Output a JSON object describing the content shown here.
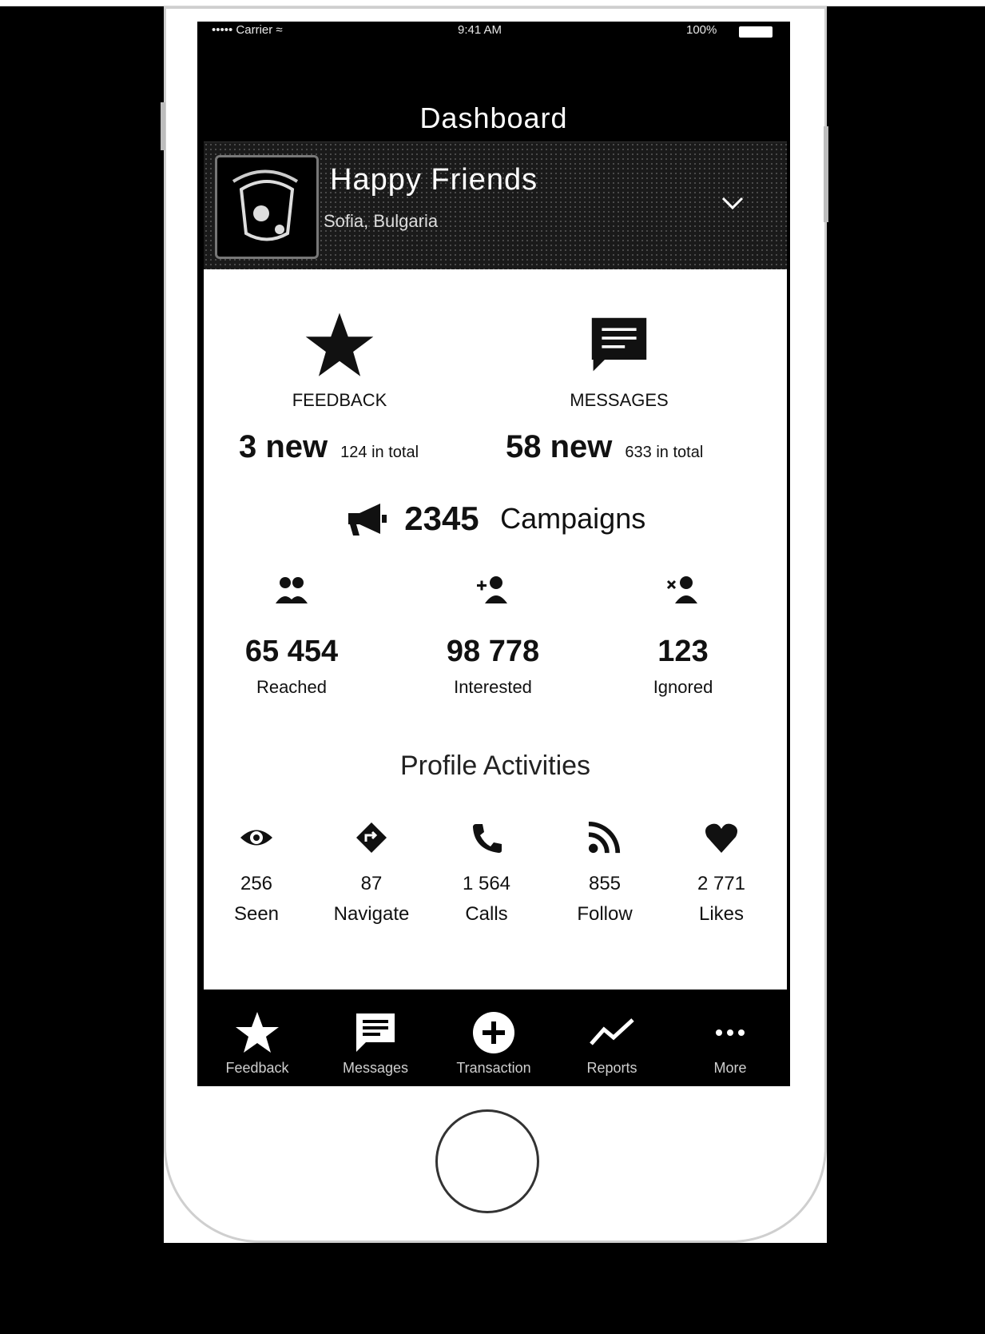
{
  "status_bar": {
    "carrier": "••••• Carrier ≈",
    "time": "9:41 AM",
    "battery": "100%"
  },
  "nav": {
    "title": "Dashboard"
  },
  "profile": {
    "name": "Happy Friends",
    "location": "Sofia, Bulgaria"
  },
  "feedback": {
    "label": "FEEDBACK",
    "new": "3 new",
    "total": "124 in total"
  },
  "messages": {
    "label": "MESSAGES",
    "new": "58 new",
    "total": "633 in total"
  },
  "campaigns": {
    "count": "2345",
    "label": "Campaigns"
  },
  "audience": [
    {
      "icon": "group-icon",
      "value": "65 454",
      "label": "Reached"
    },
    {
      "icon": "add-user-icon",
      "value": "98 778",
      "label": "Interested"
    },
    {
      "icon": "remove-user-icon",
      "value": "123",
      "label": "Ignored"
    }
  ],
  "profile_activities": {
    "title": "Profile Activities",
    "items": [
      {
        "icon": "eye-icon",
        "value": "256",
        "label": "Seen"
      },
      {
        "icon": "navigate-icon",
        "value": "87",
        "label": "Navigate"
      },
      {
        "icon": "phone-icon",
        "value": "1 564",
        "label": "Calls"
      },
      {
        "icon": "rss-icon",
        "value": "855",
        "label": "Follow"
      },
      {
        "icon": "heart-icon",
        "value": "2 771",
        "label": "Likes"
      }
    ]
  },
  "tabs": [
    {
      "icon": "star-icon",
      "label": "Feedback"
    },
    {
      "icon": "message-icon",
      "label": "Messages"
    },
    {
      "icon": "plus-circle-icon",
      "label": "Transaction"
    },
    {
      "icon": "trend-icon",
      "label": "Reports"
    },
    {
      "icon": "more-icon",
      "label": "More"
    }
  ],
  "colors": {
    "accent": "#000000",
    "content_bg": "#ffffff",
    "tab_label": "#cfcfcf"
  }
}
